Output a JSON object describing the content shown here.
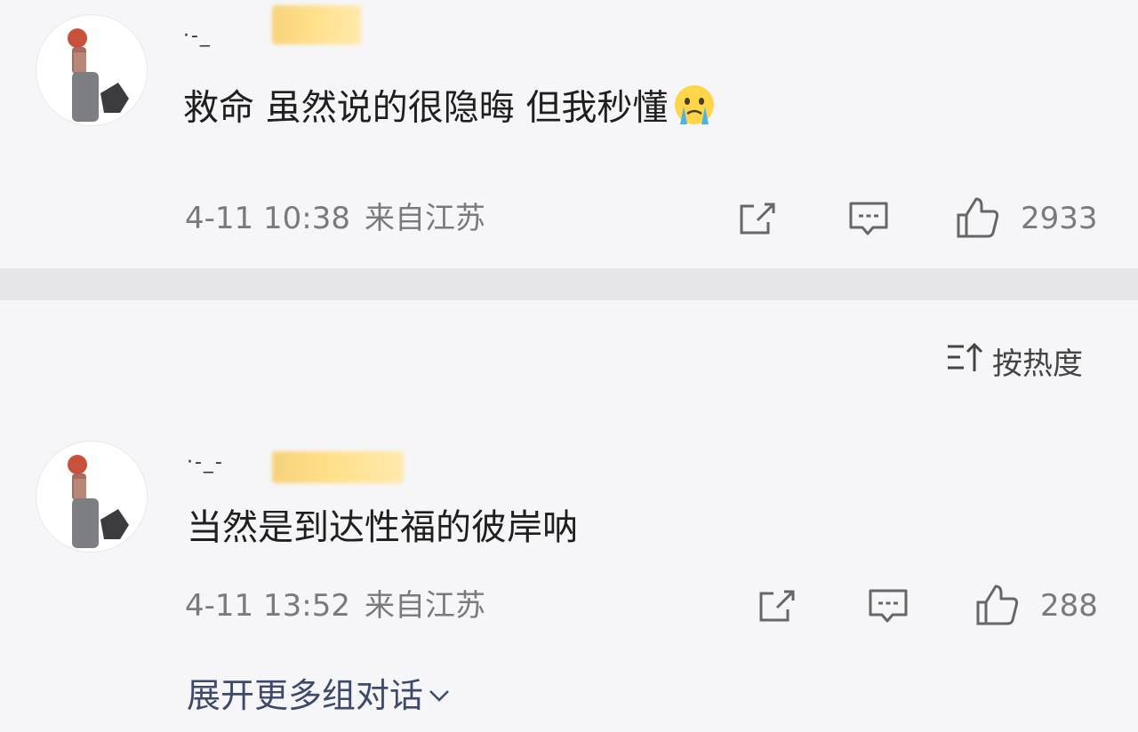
{
  "comments": [
    {
      "username_prefix": "·-_",
      "text": "救命 虽然说的很隐晦 但我秒懂",
      "emoji": "crying-emoji",
      "date": "4-11 10:38",
      "location": "来自江苏",
      "likes": "2933"
    },
    {
      "username_prefix": "·-_-",
      "text": "当然是到达性福的彼岸呐",
      "date": "4-11 13:52",
      "location": "来自江苏",
      "likes": "288"
    }
  ],
  "sort": {
    "label": "按热度",
    "icon": "sort-icon"
  },
  "expand": {
    "label": "展开更多组对话",
    "icon": "chevron-down-icon"
  },
  "icons": {
    "share": "share-icon",
    "comment": "comment-icon",
    "like": "thumbs-up-icon"
  },
  "colors": {
    "background": "#f6f6f8",
    "divider": "#e6e6e9",
    "meta_text": "#7a7a7e",
    "link": "#3d4a6b",
    "name_blur": "#ffe08a"
  }
}
